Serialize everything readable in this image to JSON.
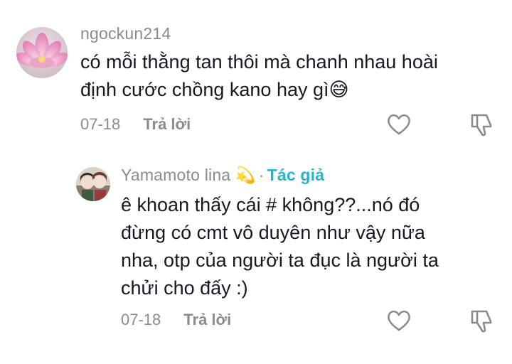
{
  "comment": {
    "username": "ngockun214",
    "text_line1": "có mỗi thằng tan thôi mà chanh nhau hoài",
    "text_line2": "định cước chồng kano hay gì",
    "emoji": "😅",
    "date": "07-18",
    "reply_label": "Trả lời"
  },
  "reply": {
    "username": "Yamamoto lina",
    "username_emoji": "💫",
    "author_tag": "Tác giả",
    "text_line1": "ê khoan thấy cái # không??...nó đó",
    "text_line2": "đừng có cmt vô duyên như vậy nữa",
    "text_line3": "nha, otp của người ta đục là người ta",
    "text_line4": "chửi cho đấy :)",
    "date": "07-18",
    "reply_label": "Trả lời"
  },
  "colors": {
    "author_tag": "#2bb3c8",
    "meta_gray": "#8a8b91",
    "text": "#161823"
  }
}
